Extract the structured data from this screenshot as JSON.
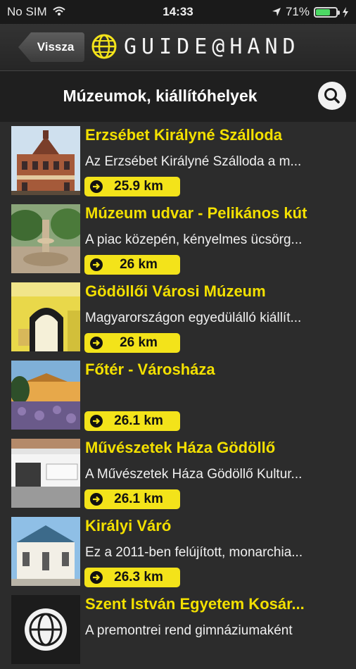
{
  "status": {
    "carrier": "No SIM",
    "time": "14:33",
    "battery": "71%",
    "battery_level": 0.71
  },
  "nav": {
    "back_label": "Vissza",
    "brand": "GUIDE@HAND"
  },
  "header": {
    "title": "Múzeumok, kiállítóhelyek"
  },
  "items": [
    {
      "title": "Erzsébet Királyné Szálloda",
      "desc": "Az Erzsébet Királyné Szálloda a m...",
      "distance": "25.9 km"
    },
    {
      "title": "Múzeum udvar - Pelikános kút",
      "desc": "A piac közepén, kényelmes ücsörg...",
      "distance": "26 km"
    },
    {
      "title": "Gödöllői Városi Múzeum",
      "desc": "Magyarországon egyedülálló kiállít...",
      "distance": "26 km"
    },
    {
      "title": "Főtér - Városháza",
      "desc": "",
      "distance": "26.1 km"
    },
    {
      "title": "Művészetek Háza Gödöllő",
      "desc": "A Művészetek Háza Gödöllő Kultur...",
      "distance": "26.1 km"
    },
    {
      "title": "Királyi Váró",
      "desc": "Ez a 2011-ben felújított, monarchia...",
      "distance": "26.3 km"
    },
    {
      "title": "Szent István Egyetem Kosár...",
      "desc": "A premontrei rend gimnáziumaként",
      "distance": ""
    }
  ]
}
